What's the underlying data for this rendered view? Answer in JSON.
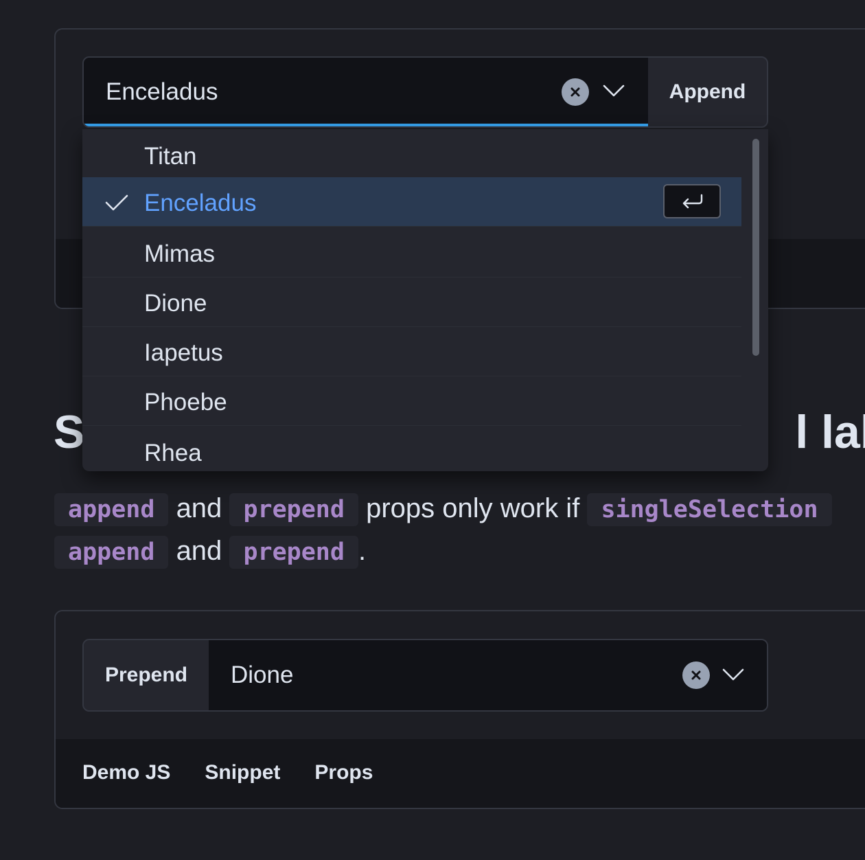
{
  "demo_top": {
    "combo": {
      "value": "Enceladus",
      "append_label": "Append"
    },
    "options": [
      {
        "label": "Titan",
        "selected": false
      },
      {
        "label": "Enceladus",
        "selected": true
      },
      {
        "label": "Mimas",
        "selected": false
      },
      {
        "label": "Dione",
        "selected": false
      },
      {
        "label": "Iapetus",
        "selected": false
      },
      {
        "label": "Phoebe",
        "selected": false
      },
      {
        "label": "Rhea",
        "selected": false
      }
    ]
  },
  "section": {
    "heading_left": "S",
    "heading_right": "l labe",
    "paragraph": {
      "line1": {
        "code1": "append",
        "text1": "and",
        "code2": "prepend",
        "text2": "props only work if",
        "code3": "singleSelection"
      },
      "line2": {
        "code1": "append",
        "text1": "and",
        "code2": "prepend",
        "text2": "."
      }
    }
  },
  "demo_bottom": {
    "combo": {
      "prepend_label": "Prepend",
      "value": "Dione"
    },
    "tabs": [
      "Demo JS",
      "Snippet",
      "Props"
    ]
  },
  "colors": {
    "background": "#1d1e24",
    "accent": "#36a2ef",
    "selected_text": "#61a2ff",
    "code_text": "#a887c9"
  }
}
